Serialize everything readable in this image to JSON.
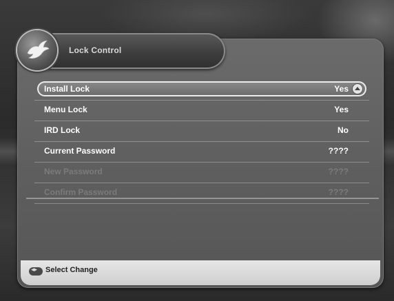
{
  "header": {
    "title": "Lock Control"
  },
  "menu": {
    "items": [
      {
        "label": "Install Lock",
        "value": "Yes"
      },
      {
        "label": "Menu Lock",
        "value": "Yes"
      },
      {
        "label": "IRD Lock",
        "value": "No"
      },
      {
        "label": "Current Password",
        "value": "????"
      },
      {
        "label": "New Password",
        "value": "????"
      },
      {
        "label": "Confirm Password",
        "value": "????"
      }
    ]
  },
  "footer": {
    "key_glyph": "◂▸",
    "hint": "Select Change"
  },
  "colors": {
    "panel": "#616161",
    "highlight_outline": "#ececec",
    "footer": "#dcdcdc",
    "disabled_text": "#7b7b7b"
  },
  "icons": {
    "logo": "bird-emblem-icon",
    "selected_arrow": "arrow-up-icon"
  }
}
